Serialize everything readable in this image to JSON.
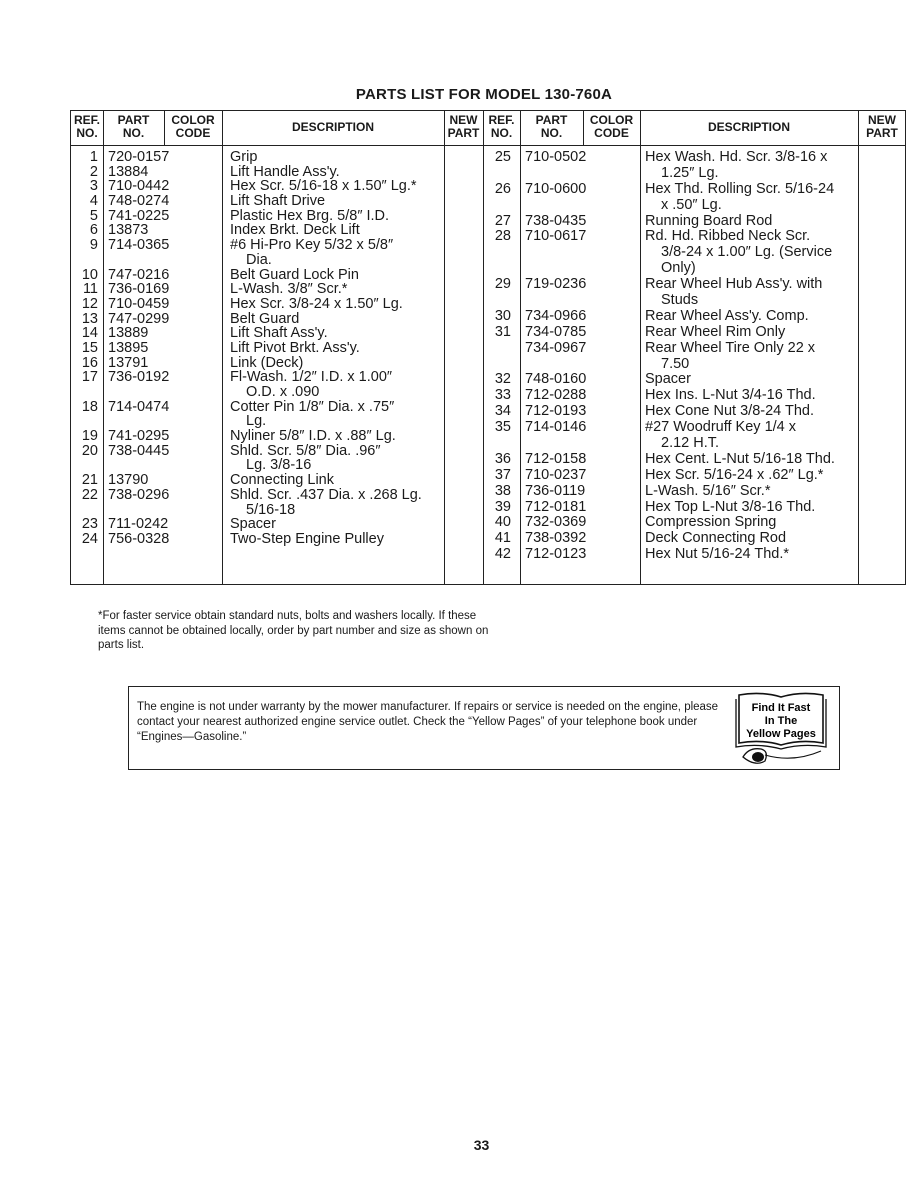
{
  "title": "PARTS LIST FOR MODEL 130-760A",
  "headers": {
    "ref": [
      "REF.",
      "NO."
    ],
    "part": [
      "PART",
      "NO."
    ],
    "color": [
      "COLOR",
      "CODE"
    ],
    "description": "DESCRIPTION",
    "new": [
      "NEW",
      "PART"
    ]
  },
  "left_parts": [
    {
      "ref": "1",
      "part": "720-0157",
      "desc": [
        "Grip"
      ]
    },
    {
      "ref": "2",
      "part": "13884",
      "desc": [
        "Lift Handle Ass'y."
      ]
    },
    {
      "ref": "3",
      "part": "710-0442",
      "desc": [
        "Hex Scr. 5/16-18 x 1.50″ Lg.*"
      ]
    },
    {
      "ref": "4",
      "part": "748-0274",
      "desc": [
        "Lift Shaft Drive"
      ]
    },
    {
      "ref": "5",
      "part": "741-0225",
      "desc": [
        "Plastic Hex Brg. 5/8″ I.D."
      ]
    },
    {
      "ref": "6",
      "part": "13873",
      "desc": [
        "Index Brkt. Deck Lift"
      ]
    },
    {
      "ref": "9",
      "part": "714-0365",
      "desc": [
        "#6 Hi-Pro Key 5/32 x 5/8″",
        "Dia."
      ]
    },
    {
      "ref": "10",
      "part": "747-0216",
      "desc": [
        "Belt Guard Lock Pin"
      ]
    },
    {
      "ref": "11",
      "part": "736-0169",
      "desc": [
        "L-Wash. 3/8″ Scr.*"
      ]
    },
    {
      "ref": "12",
      "part": "710-0459",
      "desc": [
        "Hex Scr. 3/8-24 x 1.50″ Lg."
      ]
    },
    {
      "ref": "13",
      "part": "747-0299",
      "desc": [
        "Belt Guard"
      ]
    },
    {
      "ref": "14",
      "part": "13889",
      "desc": [
        "Lift Shaft Ass'y."
      ]
    },
    {
      "ref": "15",
      "part": "13895",
      "desc": [
        "Lift Pivot Brkt. Ass'y."
      ]
    },
    {
      "ref": "16",
      "part": "13791",
      "desc": [
        "Link (Deck)"
      ]
    },
    {
      "ref": "17",
      "part": "736-0192",
      "desc": [
        "Fl-Wash. 1/2″ I.D. x 1.00″",
        "O.D. x .090"
      ]
    },
    {
      "ref": "18",
      "part": "714-0474",
      "desc": [
        "Cotter Pin 1/8″ Dia. x .75″",
        "Lg."
      ]
    },
    {
      "ref": "19",
      "part": "741-0295",
      "desc": [
        "Nyliner 5/8″ I.D. x .88″ Lg."
      ]
    },
    {
      "ref": "20",
      "part": "738-0445",
      "desc": [
        "Shld. Scr. 5/8″ Dia. .96″",
        "Lg. 3/8-16"
      ]
    },
    {
      "ref": "21",
      "part": "13790",
      "desc": [
        "Connecting Link"
      ]
    },
    {
      "ref": "22",
      "part": "738-0296",
      "desc": [
        "Shld. Scr. .437 Dia. x .268 Lg.",
        "5/16-18"
      ]
    },
    {
      "ref": "23",
      "part": "711-0242",
      "desc": [
        "Spacer"
      ]
    },
    {
      "ref": "24",
      "part": "756-0328",
      "desc": [
        "Two-Step Engine Pulley"
      ]
    }
  ],
  "right_parts": [
    {
      "ref": "25",
      "part": "710-0502",
      "desc": [
        "Hex Wash. Hd. Scr. 3/8-16 x",
        "1.25″ Lg."
      ]
    },
    {
      "ref": "26",
      "part": "710-0600",
      "desc": [
        "Hex Thd. Rolling Scr. 5/16-24",
        "x .50″ Lg."
      ]
    },
    {
      "ref": "27",
      "part": "738-0435",
      "desc": [
        "Running Board Rod"
      ]
    },
    {
      "ref": "28",
      "part": "710-0617",
      "desc": [
        "Rd. Hd. Ribbed Neck Scr.",
        "3/8-24 x 1.00″ Lg. (Service",
        "Only)"
      ]
    },
    {
      "ref": "29",
      "part": "719-0236",
      "desc": [
        "Rear Wheel Hub Ass'y. with",
        "Studs"
      ]
    },
    {
      "ref": "30",
      "part": "734-0966",
      "desc": [
        "Rear Wheel Ass'y. Comp."
      ]
    },
    {
      "ref": "31",
      "part": "734-0785",
      "desc": [
        "Rear Wheel Rim Only"
      ]
    },
    {
      "ref": "",
      "part": "734-0967",
      "desc": [
        "Rear Wheel Tire Only 22 x",
        "7.50"
      ]
    },
    {
      "ref": "32",
      "part": "748-0160",
      "desc": [
        "Spacer"
      ]
    },
    {
      "ref": "33",
      "part": "712-0288",
      "desc": [
        "Hex Ins. L-Nut 3/4-16 Thd."
      ]
    },
    {
      "ref": "34",
      "part": "712-0193",
      "desc": [
        "Hex Cone Nut 3/8-24 Thd."
      ]
    },
    {
      "ref": "35",
      "part": "714-0146",
      "desc": [
        "#27 Woodruff Key 1/4 x",
        "2.12 H.T."
      ]
    },
    {
      "ref": "36",
      "part": "712-0158",
      "desc": [
        "Hex Cent. L-Nut 5/16-18 Thd."
      ]
    },
    {
      "ref": "37",
      "part": "710-0237",
      "desc": [
        "Hex Scr. 5/16-24 x .62″ Lg.*"
      ]
    },
    {
      "ref": "38",
      "part": "736-0119",
      "desc": [
        "L-Wash. 5/16″ Scr.*"
      ]
    },
    {
      "ref": "39",
      "part": "712-0181",
      "desc": [
        "Hex Top L-Nut 3/8-16 Thd."
      ]
    },
    {
      "ref": "40",
      "part": "732-0369",
      "desc": [
        "Compression Spring"
      ]
    },
    {
      "ref": "41",
      "part": "738-0392",
      "desc": [
        "Deck Connecting Rod"
      ]
    },
    {
      "ref": "42",
      "part": "712-0123",
      "desc": [
        "Hex Nut 5/16-24 Thd.*"
      ]
    }
  ],
  "footnote": "*For faster service obtain standard nuts, bolts and washers locally. If these items cannot be obtained locally, order by part number and size as shown on parts list.",
  "notice": "The engine is not under warranty by the mower manufacturer. If repairs or service is needed on the engine, please contact your nearest authorized engine service outlet. Check the “Yellow Pages” of your telephone book under “Engines—Gasoline.”",
  "logo": {
    "lines": [
      "Find It Fast",
      "In The",
      "Yellow Pages"
    ],
    "icon": "open-book-telephone-icon"
  },
  "page_number": "33"
}
